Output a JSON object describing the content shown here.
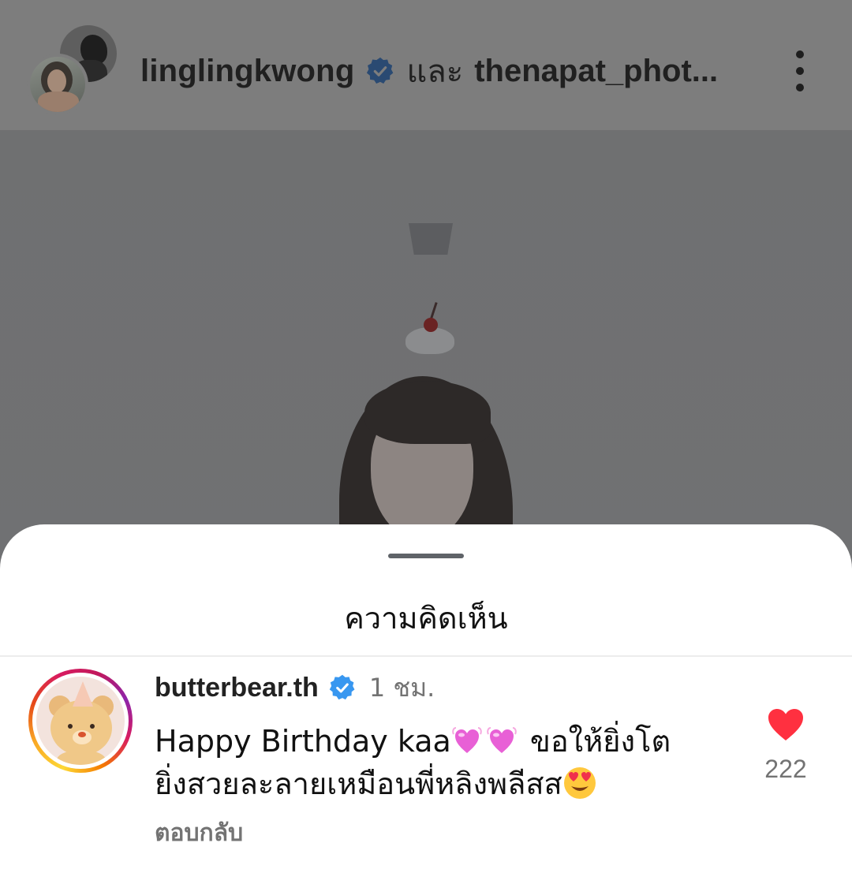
{
  "post_header": {
    "author_1": "linglingkwong",
    "conjunction": "และ",
    "author_2": "thenapat_phot...",
    "icons": {
      "verified": "verified-badge-icon",
      "more": "more-vertical-icon"
    }
  },
  "comments_sheet": {
    "title": "ความคิดเห็น",
    "comment": {
      "username": "butterbear.th",
      "time": "1 ชม.",
      "text_line_1_a": "Happy Birthday kaa",
      "text_line_1_b": " ขอให้ยิ่งโต",
      "text_line_2": "ยิ่งสวยละลายเหมือนพี่หลิงพลีสส",
      "reply_label": "ตอบกลับ",
      "like_count": "222",
      "icons": {
        "heart_emoji": "pink-beating-heart-emoji",
        "face_emoji": "heart-eyes-emoji",
        "like": "like-heart-icon"
      }
    }
  },
  "colors": {
    "verified_blue": "#3897f0",
    "like_red": "#ff3040",
    "secondary_text": "#737373",
    "overlay": "#7d7d7d"
  }
}
